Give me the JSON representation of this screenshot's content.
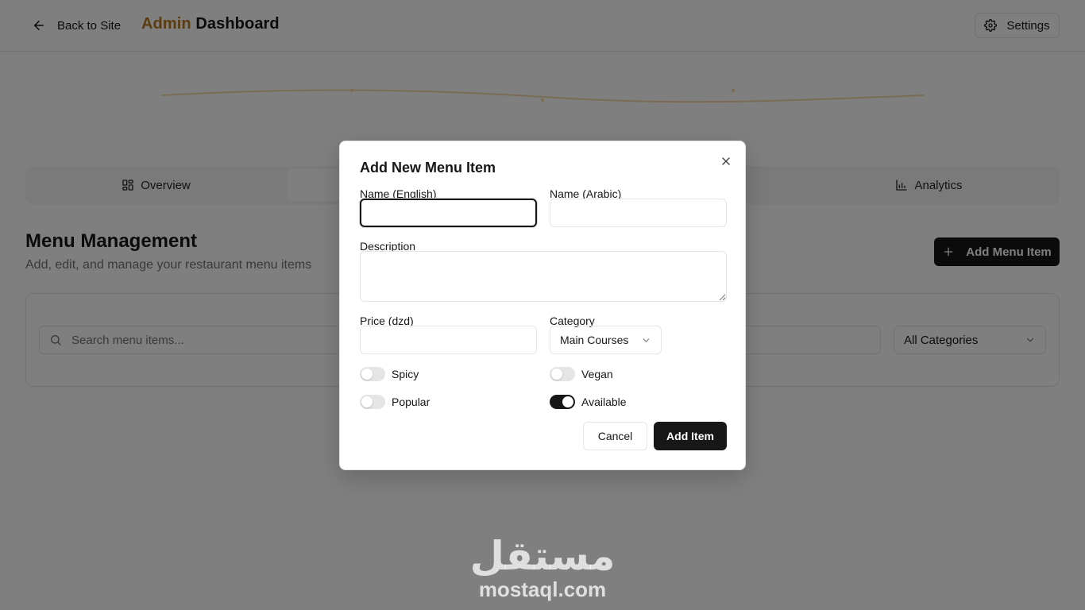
{
  "header": {
    "back_label": "Back to Site",
    "brand_accent": "Admin",
    "brand_rest": " Dashboard",
    "settings_label": "Settings"
  },
  "tabs": [
    {
      "label": "Overview",
      "icon": "grid-icon"
    },
    {
      "label": "",
      "icon": ""
    },
    {
      "label": "Analytics",
      "icon": "bar-chart-icon"
    }
  ],
  "section": {
    "title": "Menu Management",
    "subtitle": "Add, edit, and manage your restaurant menu items",
    "add_button": "Add Menu Item"
  },
  "filters": {
    "search_placeholder": "Search menu items...",
    "category_value": "All Categories"
  },
  "modal": {
    "title": "Add New Menu Item",
    "name_en_label": "Name (English)",
    "name_en_value": "",
    "name_ar_label": "Name (Arabic)",
    "name_ar_value": "",
    "description_label": "Description",
    "description_value": "",
    "price_label": "Price (dzd)",
    "price_value": "",
    "category_label": "Category",
    "category_value": "Main Courses",
    "toggles": {
      "spicy": {
        "label": "Spicy",
        "on": false
      },
      "vegan": {
        "label": "Vegan",
        "on": false
      },
      "popular": {
        "label": "Popular",
        "on": false
      },
      "available": {
        "label": "Available",
        "on": true
      }
    },
    "cancel_label": "Cancel",
    "submit_label": "Add Item"
  },
  "watermark": {
    "arabic": "مستقل",
    "latin": "mostaql.com"
  },
  "colors": {
    "brand_accent": "#b7791f",
    "primary": "#171717",
    "overlay": "rgba(0,0,0,0.5)"
  }
}
